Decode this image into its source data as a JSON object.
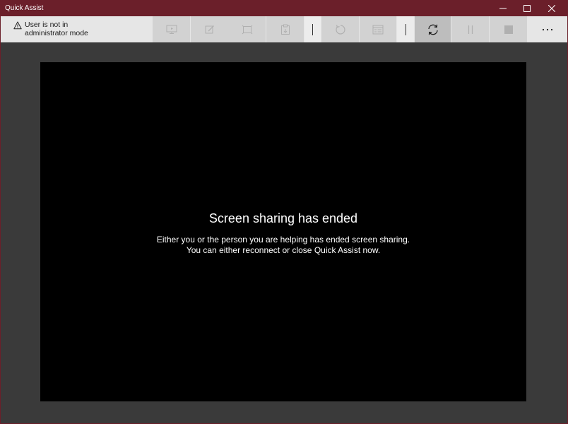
{
  "window": {
    "title": "Quick Assist",
    "accent_color": "#6b1f2a"
  },
  "toolbar": {
    "status_text": "User is not in administrator mode",
    "status_icon": "warning-icon",
    "buttons": [
      {
        "icon": "monitor-icon",
        "enabled": false
      },
      {
        "icon": "annotate-pen-icon",
        "enabled": false
      },
      {
        "icon": "actual-size-icon",
        "enabled": false
      },
      {
        "icon": "clipboard-icon",
        "enabled": false
      },
      {
        "icon": "restart-icon",
        "enabled": false
      },
      {
        "icon": "task-manager-icon",
        "enabled": false
      },
      {
        "icon": "reconnect-icon",
        "enabled": true
      },
      {
        "icon": "pause-icon",
        "enabled": false
      },
      {
        "icon": "stop-icon",
        "enabled": false
      },
      {
        "icon": "more-icon",
        "label": "...",
        "enabled": true
      }
    ]
  },
  "screen": {
    "heading": "Screen sharing has ended",
    "line1": "Either you or the person you are helping has ended screen sharing.",
    "line2": "You can either reconnect or close Quick Assist now."
  }
}
